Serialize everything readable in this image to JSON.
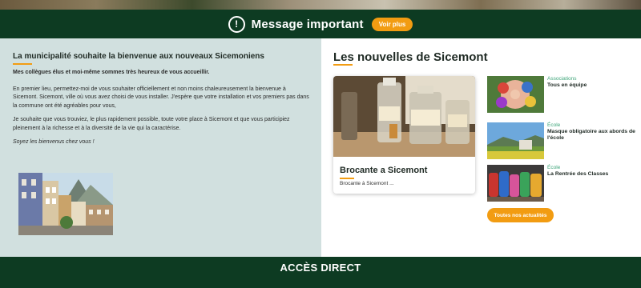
{
  "alert": {
    "icon": "exclamation-circle-icon",
    "message": "Message important",
    "button_label": "Voir plus",
    "accent_color": "#f29c12",
    "bar_color": "#0d3b22"
  },
  "welcome": {
    "title": "La municipalité souhaite la bienvenue aux nouveaux Sicemoniens",
    "lead": "Mes collègues élus et moi-même sommes très heureux de vous accueillir.",
    "paragraph1": "En premier lieu, permettez-moi de vous souhaiter officiellement et non moins chaleureusement la bienvenue à Sicemont. Sicemont, ville où vous avez choisi de vous installer. J'espère que votre installation et vos premiers pas dans la commune ont été agréables pour vous,",
    "paragraph2": "Je souhaite que vous trouviez, le plus rapidement possible, toute votre place à Sicemont et que vous participiez pleinement à la richesse et à la diversité de la vie qui la caractérise.",
    "closing": "Soyez les bienvenus chez vous !",
    "background_color": "#d1e0df"
  },
  "news": {
    "title": "Les nouvelles de Sicemont",
    "featured": {
      "title": "Brocante a Sicemont",
      "excerpt": "Brocante à Sicemont ..."
    },
    "items": [
      {
        "category": "Associations",
        "title": "Tous en équipe"
      },
      {
        "category": "École",
        "title": "Masque obligatoire aux abords de l'école"
      },
      {
        "category": "École",
        "title": "La Rentrée des Classes"
      }
    ],
    "all_button_label": "Toutes nos actualités"
  },
  "footer": {
    "title": "ACCÈS DIRECT"
  }
}
